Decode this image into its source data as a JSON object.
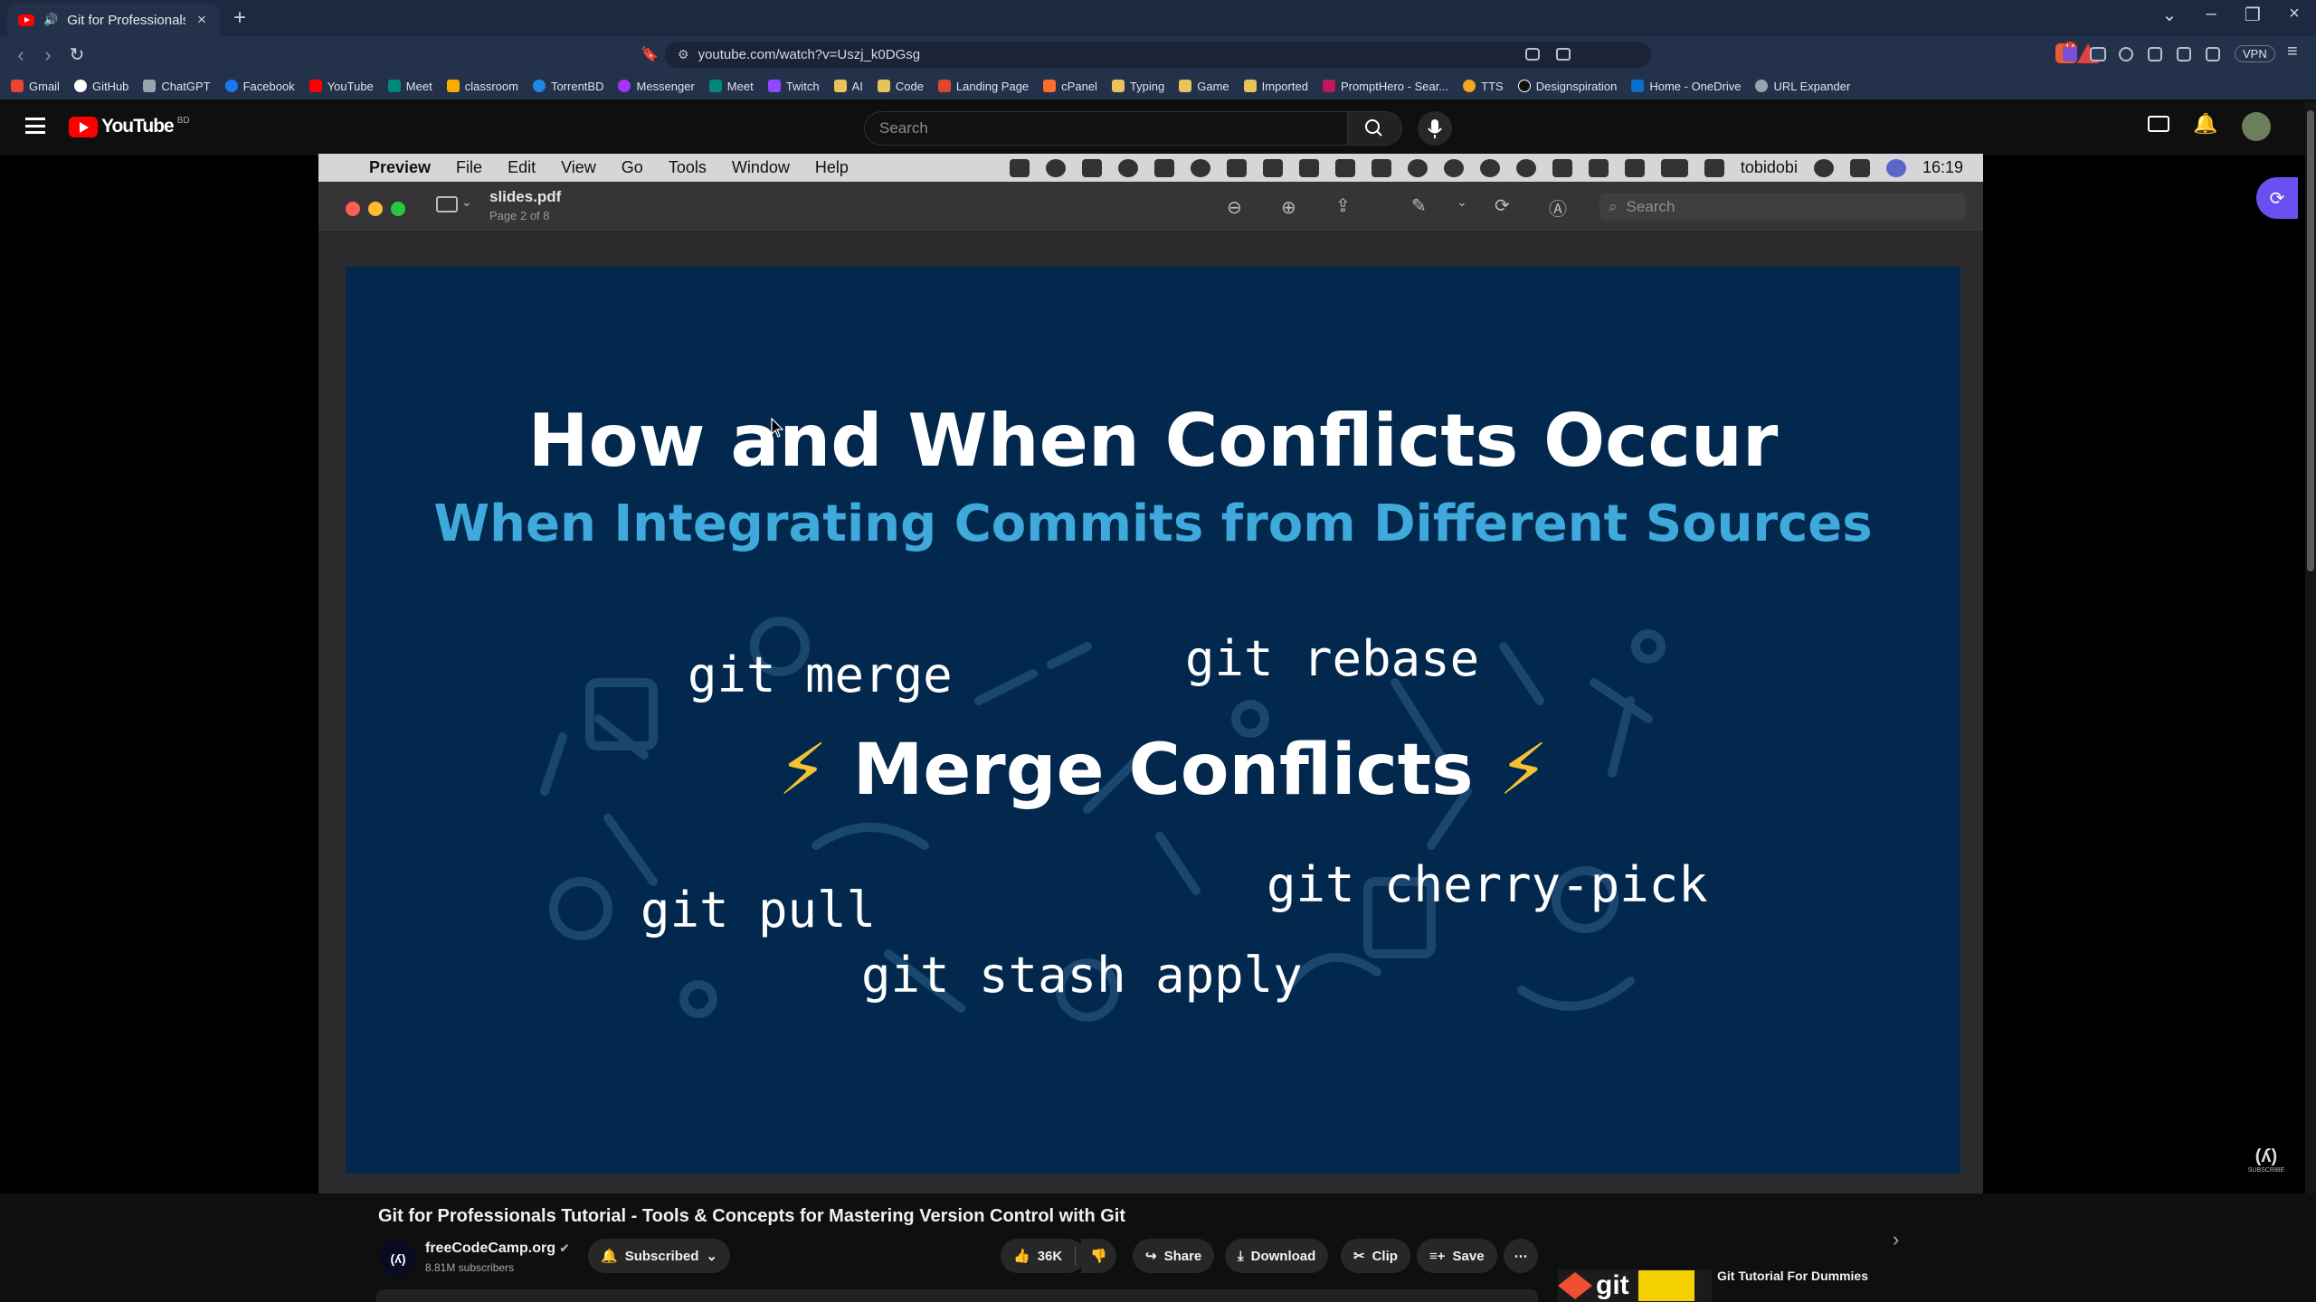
{
  "browser": {
    "tab_title": "Git for Professionals Tutorial",
    "url": "youtube.com/watch?v=Uszj_k0DGsg",
    "vpn_label": "VPN",
    "extension_badge": "14",
    "bookmarks": [
      "Gmail",
      "GitHub",
      "ChatGPT",
      "Facebook",
      "YouTube",
      "Meet",
      "classroom",
      "TorrentBD",
      "Messenger",
      "Meet",
      "Twitch",
      "AI",
      "Code",
      "Landing Page",
      "cPanel",
      "Typing",
      "Game",
      "Imported",
      "PromptHero - Sear...",
      "TTS",
      "Designspiration",
      "Home - OneDrive",
      "URL Expander"
    ]
  },
  "youtube": {
    "logo_text": "YouTube",
    "logo_region": "BD",
    "search_placeholder": "Search"
  },
  "mac": {
    "menu": [
      "Preview",
      "File",
      "Edit",
      "View",
      "Go",
      "Tools",
      "Window",
      "Help"
    ],
    "username": "tobidobi",
    "clock": "16:19",
    "doc_title": "slides.pdf",
    "doc_page": "Page 2 of 8",
    "search_placeholder": "Search"
  },
  "slide": {
    "title": "How and When Conflicts Occur",
    "subtitle": "When Integrating Commits from Different Sources",
    "center": "Merge Conflicts",
    "commands": [
      "git merge",
      "git rebase",
      "git pull",
      "git cherry-pick",
      "git stash apply"
    ]
  },
  "video": {
    "title": "Git for Professionals Tutorial - Tools & Concepts for Mastering Version Control with Git",
    "channel": "freeCodeCamp.org",
    "subscribers": "8.81M subscribers",
    "subscribed_label": "Subscribed",
    "likes": "36K",
    "share": "Share",
    "download": "Download",
    "clip": "Clip",
    "save": "Save",
    "watermark": "SUBSCRIBE",
    "next_video_title": "Git Tutorial For Dummies",
    "next_video_thumb_text": "git"
  },
  "colors": {
    "slide_bg": "#02284d",
    "slide_subtitle": "#3fa9dc",
    "yt_red": "#ff0000"
  }
}
